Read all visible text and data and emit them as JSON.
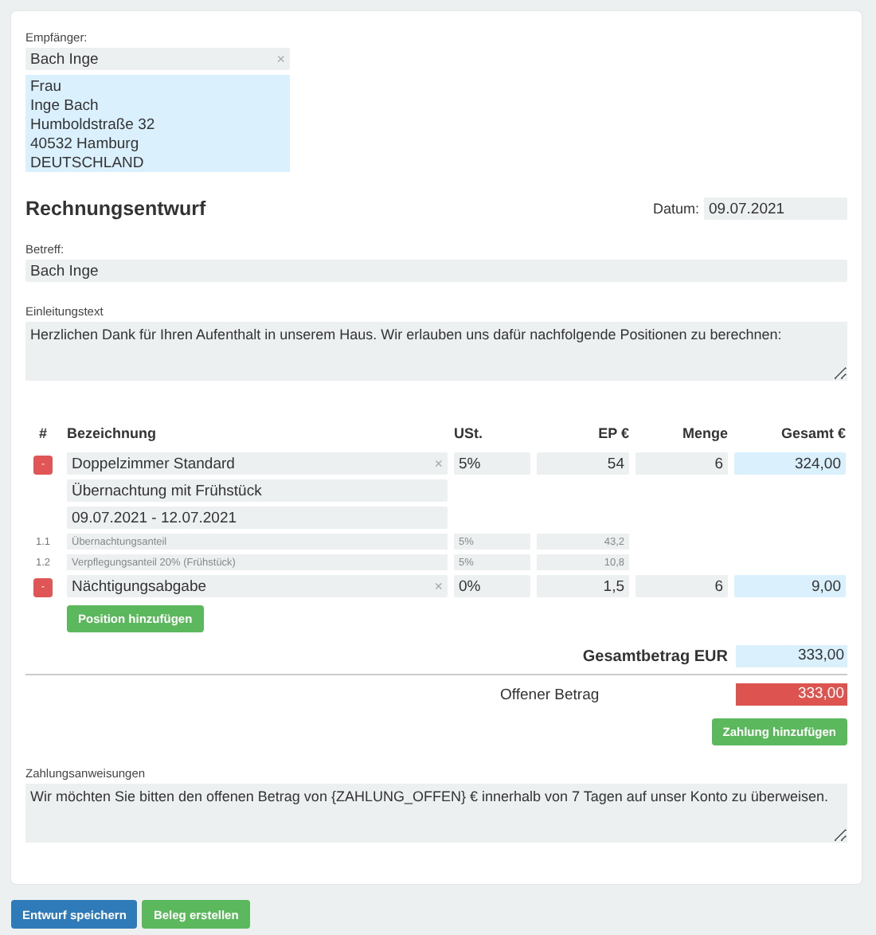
{
  "recipient": {
    "label": "Empfänger:",
    "value": "Bach Inge",
    "clear": "×",
    "address": [
      "Frau",
      "Inge Bach",
      "Humboldstraße 32",
      "40532 Hamburg",
      "DEUTSCHLAND"
    ]
  },
  "heading": "Rechnungsentwurf",
  "date": {
    "label": "Datum:",
    "value": "09.07.2021"
  },
  "subject": {
    "label": "Betreff:",
    "value": "Bach Inge"
  },
  "intro": {
    "label": "Einleitungstext",
    "value": "Herzlichen Dank für Ihren Aufenthalt in unserem Haus. Wir erlauben uns dafür nachfolgende Positionen zu berechnen:"
  },
  "table": {
    "columns": [
      "#",
      "Bezeichnung",
      "USt.",
      "EP €",
      "Menge",
      "Gesamt €"
    ],
    "positions": [
      {
        "remove": "-",
        "name": "Doppelzimmer Standard",
        "clear": "×",
        "vat": "5%",
        "price": "54",
        "qty": "6",
        "total": "324,00",
        "lines": [
          "Übernachtung mit Frühstück",
          "09.07.2021 - 12.07.2021"
        ],
        "subitems": [
          {
            "number": "1.1",
            "name": "Übernachtungsanteil",
            "vat": "5%",
            "price": "43,2"
          },
          {
            "number": "1.2",
            "name": "Verpflegungsanteil 20% (Frühstück)",
            "vat": "5%",
            "price": "10,8"
          }
        ]
      },
      {
        "remove": "-",
        "name": "Nächtigungsabgabe",
        "clear": "×",
        "vat": "0%",
        "price": "1,5",
        "qty": "6",
        "total": "9,00"
      }
    ],
    "add_button": "Position hinzufügen"
  },
  "total": {
    "label": "Gesamtbetrag EUR",
    "value": "333,00"
  },
  "open": {
    "label": "Offener Betrag",
    "value": "333,00"
  },
  "add_payment": "Zahlung hinzufügen",
  "payment": {
    "label": "Zahlungsanweisungen",
    "value": "Wir möchten Sie bitten den offenen Betrag von {ZAHLUNG_OFFEN} € innerhalb von 7 Tagen auf unser Konto zu überweisen."
  },
  "buttons": [
    {
      "label": "Entwurf speichern",
      "kind": "primary"
    },
    {
      "label": "Beleg erstellen",
      "kind": "success"
    }
  ]
}
